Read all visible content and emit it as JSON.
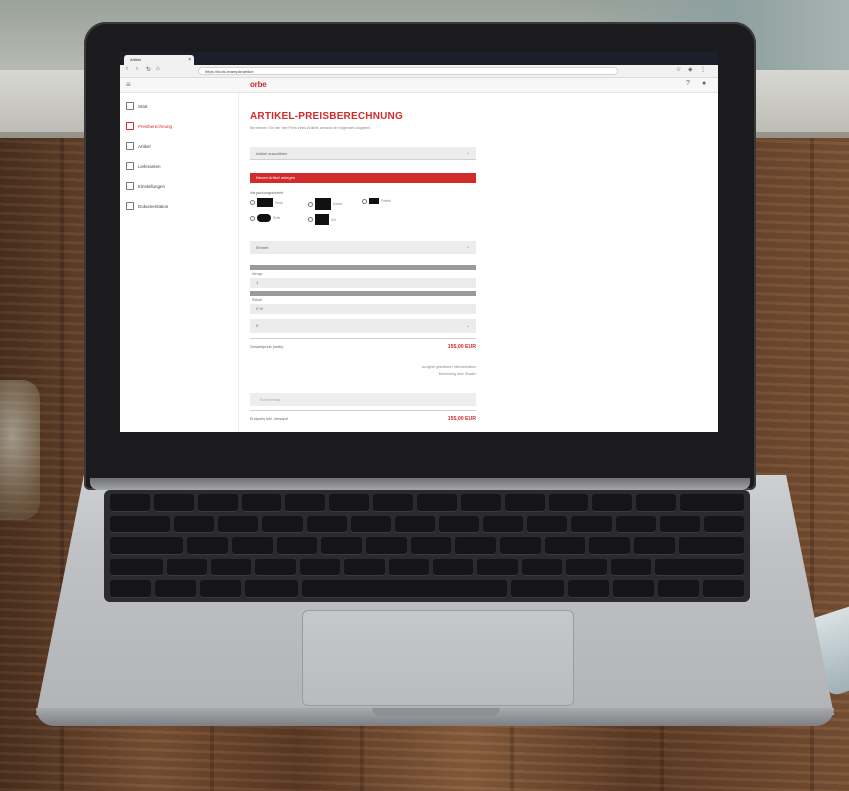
{
  "browser": {
    "tab_title": "Artikel",
    "url": "https://tools.example/artikel",
    "nav_icons": [
      "back-icon",
      "forward-icon",
      "reload-icon",
      "home-icon"
    ]
  },
  "app": {
    "logo": "orbe",
    "header_icons": [
      "help-icon",
      "user-icon"
    ]
  },
  "sidebar": {
    "items": [
      {
        "label": "Start",
        "icon": "home-icon",
        "active": false
      },
      {
        "label": "Preisberechnung",
        "icon": "calculator-icon",
        "active": true
      },
      {
        "label": "Artikel",
        "icon": "box-icon",
        "active": false
      },
      {
        "label": "Lieferanten",
        "icon": "truck-icon",
        "active": false
      },
      {
        "label": "Einstellungen",
        "icon": "gear-icon",
        "active": false
      },
      {
        "label": "Dokumentation",
        "icon": "document-icon",
        "active": false
      }
    ]
  },
  "main": {
    "title": "ARTIKEL-PREISBERECHNUNG",
    "subtitle": "Berechnen Sie hier den Preis eines Artikels anhand der folgenden Angaben.",
    "artikel_select": "Artikel auswählen",
    "primary_button": "Neuen Artikel anlegen",
    "radio_label": "Verpackungseinheit",
    "radio_options": [
      "Stück",
      "Karton",
      "Palette",
      "Rolle",
      "Set"
    ],
    "select_einheit": "Einheit",
    "field_menge_label": "Menge",
    "field_menge_value": "1",
    "field_rabatt_label": "Rabatt",
    "field_rabatt_value": "0 %",
    "select_zuschlag": "0",
    "gesamtpreis_label": "Gesamtpreis (netto)",
    "gesamtpreis_value": "155,00 EUR",
    "note_line1": "zuzüglich gesetzlicher Mehrwertsteuer",
    "note_line2": "Berechnung ohne Gewähr",
    "kommentar_placeholder": "Kommentar",
    "endpreis_label": "Endpreis inkl. Versand",
    "endpreis_value": "155,00 EUR"
  },
  "colors": {
    "accent": "#d22b2b",
    "titlebar": "#1c1f2a"
  }
}
